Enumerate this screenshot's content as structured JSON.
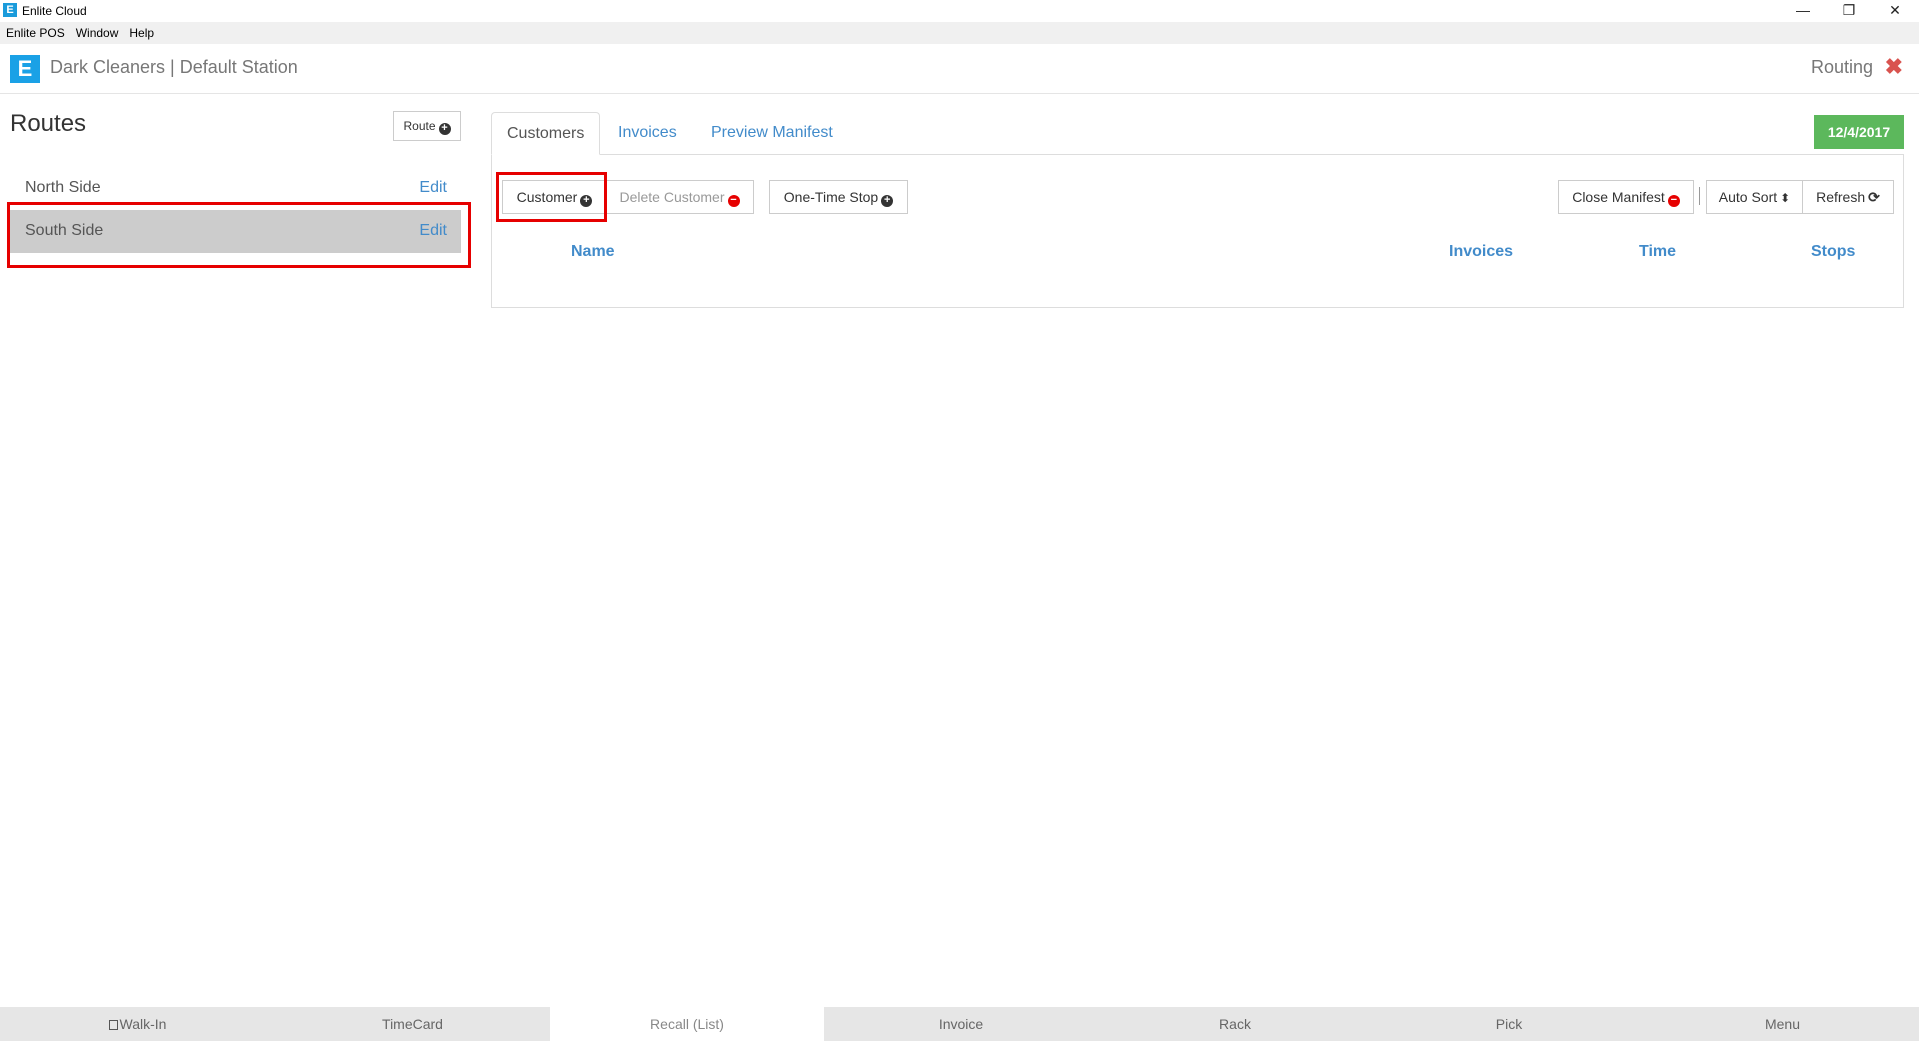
{
  "window": {
    "title": "Enlite Cloud",
    "app_icon_letter": "E",
    "minimize_glyph": "—",
    "restore_glyph": "❐",
    "close_glyph": "✕"
  },
  "menubar": {
    "items": [
      "Enlite POS",
      "Window",
      "Help"
    ]
  },
  "header": {
    "logo_letter": "E",
    "station": "Dark Cleaners | Default Station",
    "module": "Routing",
    "close_glyph": "✖",
    "close_color": "#d9534f"
  },
  "routes": {
    "title": "Routes",
    "add_button": "Route",
    "items": [
      {
        "name": "North Side",
        "edit": "Edit",
        "selected": false
      },
      {
        "name": "South Side",
        "edit": "Edit",
        "selected": true
      }
    ]
  },
  "tabs": {
    "items": [
      {
        "label": "Customers",
        "active": true
      },
      {
        "label": "Invoices",
        "active": false
      },
      {
        "label": "Preview Manifest",
        "active": false
      }
    ],
    "date_badge": "12/4/2017",
    "date_badge_color": "#5cb85c"
  },
  "toolbar": {
    "customer": "Customer",
    "delete_customer": "Delete Customer",
    "one_time_stop": "One-Time Stop",
    "close_manifest": "Close Manifest",
    "auto_sort": "Auto Sort",
    "refresh": "Refresh",
    "plus_glyph": "+",
    "minus_glyph": "−",
    "sort_glyph": "⬍",
    "refresh_glyph": "⟳"
  },
  "table": {
    "columns": [
      "Name",
      "Invoices",
      "Time",
      "Stops"
    ],
    "rows": []
  },
  "bottombar": {
    "items": [
      {
        "label": "Walk-In",
        "checkbox": true,
        "active": false
      },
      {
        "label": "TimeCard",
        "active": false
      },
      {
        "label": "Recall (List)",
        "active": true
      },
      {
        "label": "Invoice",
        "active": false
      },
      {
        "label": "Rack",
        "active": false
      },
      {
        "label": "Pick",
        "active": false
      },
      {
        "label": "Menu",
        "active": false
      }
    ]
  },
  "colors": {
    "link": "#428bca",
    "highlight_box": "#e60000",
    "selected_row": "#cccccc",
    "brand": "#1aa1e6"
  }
}
